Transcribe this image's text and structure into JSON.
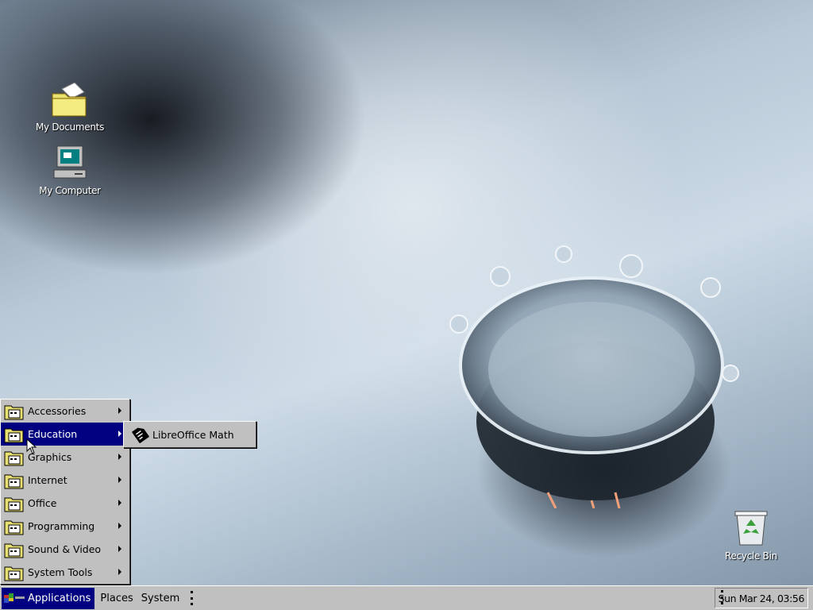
{
  "desktop": {
    "icons": [
      {
        "label": "My Documents",
        "icon": "folder-icon"
      },
      {
        "label": "My Computer",
        "icon": "computer-icon"
      },
      {
        "label": "Recycle Bin",
        "icon": "recycle-bin-icon"
      }
    ]
  },
  "applications_menu": {
    "items": [
      {
        "label": "Accessories",
        "icon": "folder-icon"
      },
      {
        "label": "Education",
        "icon": "folder-icon"
      },
      {
        "label": "Graphics",
        "icon": "folder-icon"
      },
      {
        "label": "Internet",
        "icon": "folder-icon"
      },
      {
        "label": "Office",
        "icon": "folder-icon"
      },
      {
        "label": "Programming",
        "icon": "folder-icon"
      },
      {
        "label": "Sound & Video",
        "icon": "folder-icon"
      },
      {
        "label": "System Tools",
        "icon": "folder-icon"
      }
    ],
    "selected_index": 1
  },
  "education_submenu": {
    "items": [
      {
        "label": "LibreOffice Math",
        "icon": "libreoffice-math-icon"
      }
    ]
  },
  "taskbar": {
    "applications_label": "Applications",
    "places_label": "Places",
    "system_label": "System",
    "clock": "Sun Mar 24, 03:56"
  },
  "colors": {
    "selection": "#000080",
    "panel": "#c0c0c0"
  }
}
